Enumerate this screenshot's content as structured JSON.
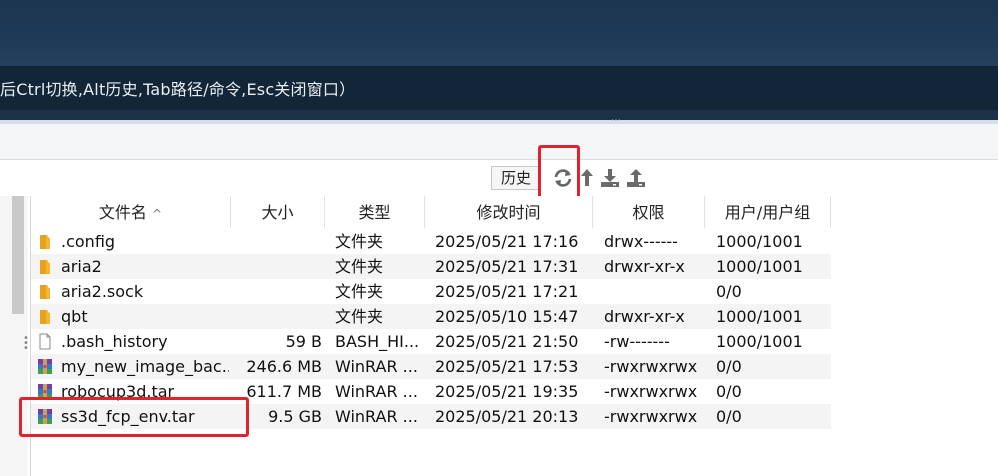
{
  "terminal": {
    "hint": "后Ctrl切换,Alt历史,Tab路径/命令,Esc关闭窗口）"
  },
  "toolbar": {
    "history_label": "历史",
    "icons": [
      "refresh-icon",
      "up-arrow-icon",
      "download-icon",
      "upload-icon"
    ]
  },
  "table": {
    "columns": [
      "文件名",
      "大小",
      "类型",
      "修改时间",
      "权限",
      "用户/用户组"
    ],
    "sort_indicator": "^",
    "rows": [
      {
        "name": ".config",
        "size": "",
        "type": "文件夹",
        "mtime": "2025/05/21 17:16",
        "perm": "drwx------",
        "owner": "1000/1001",
        "icon": "folder"
      },
      {
        "name": "aria2",
        "size": "",
        "type": "文件夹",
        "mtime": "2025/05/21 17:31",
        "perm": "drwxr-xr-x",
        "owner": "1000/1001",
        "icon": "folder"
      },
      {
        "name": "aria2.sock",
        "size": "",
        "type": "文件夹",
        "mtime": "2025/05/21 17:21",
        "perm": "",
        "owner": "0/0",
        "icon": "folder"
      },
      {
        "name": "qbt",
        "size": "",
        "type": "文件夹",
        "mtime": "2025/05/10 15:47",
        "perm": "drwxr-xr-x",
        "owner": "1000/1001",
        "icon": "folder"
      },
      {
        "name": ".bash_history",
        "size": "59 B",
        "type": "BASH_HI...",
        "mtime": "2025/05/21 21:50",
        "perm": "-rw-------",
        "owner": "1000/1001",
        "icon": "file"
      },
      {
        "name": "my_new_image_bac...",
        "size": "246.6 MB",
        "type": "WinRAR ...",
        "mtime": "2025/05/21 17:53",
        "perm": "-rwxrwxrwx",
        "owner": "0/0",
        "icon": "archive"
      },
      {
        "name": "robocup3d.tar",
        "size": "611.7 MB",
        "type": "WinRAR ...",
        "mtime": "2025/05/21 19:35",
        "perm": "-rwxrwxrwx",
        "owner": "0/0",
        "icon": "archive"
      },
      {
        "name": "ss3d_fcp_env.tar",
        "size": "9.5 GB",
        "type": "WinRAR ...",
        "mtime": "2025/05/21 20:13",
        "perm": "-rwxrwxrwx",
        "owner": "0/0",
        "icon": "archive"
      }
    ]
  },
  "colors": {
    "terminal_bg": "#1f3a57",
    "hint_bar_bg": "#122637",
    "highlight": "#e0242f",
    "folder": "#f2b732",
    "alt_row": "#f4f4f4"
  }
}
